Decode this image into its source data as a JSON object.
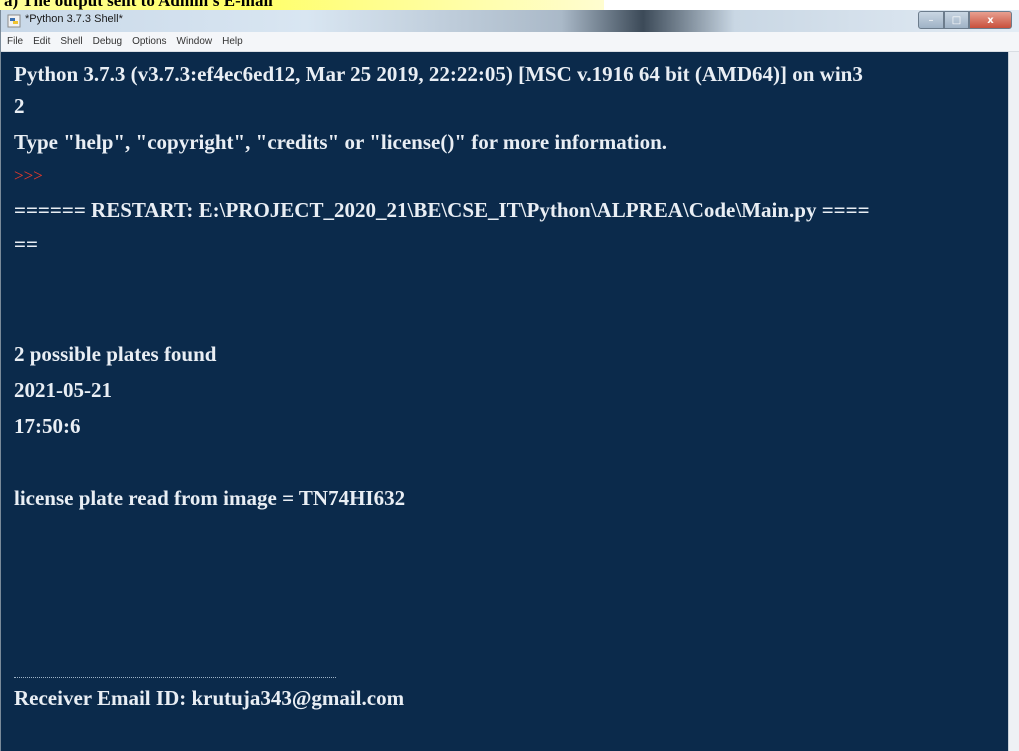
{
  "caption": "a)  The output sent to Admin's E-mail",
  "window": {
    "title": "*Python 3.7.3 Shell*",
    "controls": {
      "minimize": "–",
      "maximize": "□",
      "close": "x"
    }
  },
  "menu": [
    "File",
    "Edit",
    "Shell",
    "Debug",
    "Options",
    "Window",
    "Help"
  ],
  "shell": {
    "lines": [
      "Python 3.7.3 (v3.7.3:ef4ec6ed12, Mar 25 2019, 22:22:05) [MSC v.1916 64 bit (AMD64)] on win3",
      "2",
      "Type \"help\", \"copyright\", \"credits\" or \"license()\" for more information.",
      ">>>",
      "====== RESTART: E:\\PROJECT_2020_21\\BE\\CSE_IT\\Python\\ALPREA\\Code\\Main.py ====",
      "==",
      "2 possible plates found",
      "2021-05-21",
      "17:50:6",
      "license plate read from image = TN74HI632",
      "Receiver Email ID: krutuja343@gmail.com"
    ]
  },
  "colors": {
    "shell_background": "#0b2a4b",
    "shell_text": "#e9eef4",
    "prompt": "#e83a2a",
    "caption_highlight": "#ffff66"
  }
}
